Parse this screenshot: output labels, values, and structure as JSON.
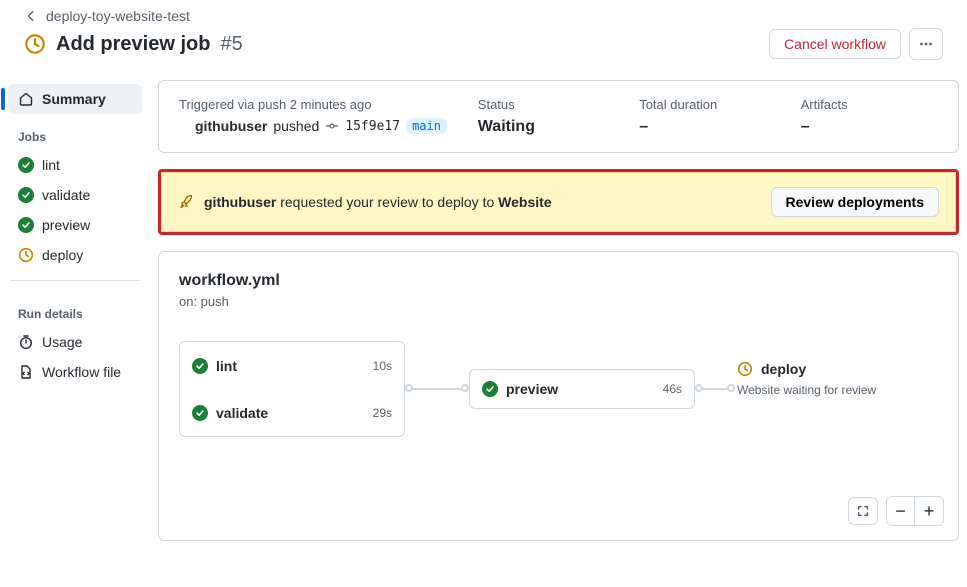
{
  "header": {
    "back_label": "deploy-toy-website-test",
    "title": "Add preview job",
    "run_number": "#5",
    "cancel_label": "Cancel workflow"
  },
  "sidebar": {
    "summary_label": "Summary",
    "jobs_label": "Jobs",
    "jobs": [
      {
        "name": "lint",
        "status": "success"
      },
      {
        "name": "validate",
        "status": "success"
      },
      {
        "name": "preview",
        "status": "success"
      },
      {
        "name": "deploy",
        "status": "waiting"
      }
    ],
    "run_details_label": "Run details",
    "usage_label": "Usage",
    "workflow_file_label": "Workflow file"
  },
  "summary": {
    "trigger_label": "Triggered via push 2 minutes ago",
    "username": "githubuser",
    "action_verb": "pushed",
    "commit_sha": "15f9e17",
    "branch": "main",
    "status_label": "Status",
    "status_value": "Waiting",
    "duration_label": "Total duration",
    "duration_value": "–",
    "artifacts_label": "Artifacts",
    "artifacts_value": "–"
  },
  "review_banner": {
    "username": "githubuser",
    "middle_text": "requested your review to deploy to",
    "environment": "Website",
    "button_label": "Review deployments"
  },
  "workflow": {
    "file_name": "workflow.yml",
    "on_line": "on: push",
    "jobs": {
      "lint": {
        "label": "lint",
        "duration": "10s"
      },
      "validate": {
        "label": "validate",
        "duration": "29s"
      },
      "preview": {
        "label": "preview",
        "duration": "46s"
      },
      "deploy": {
        "label": "deploy",
        "sub": "Website waiting for review"
      }
    }
  }
}
